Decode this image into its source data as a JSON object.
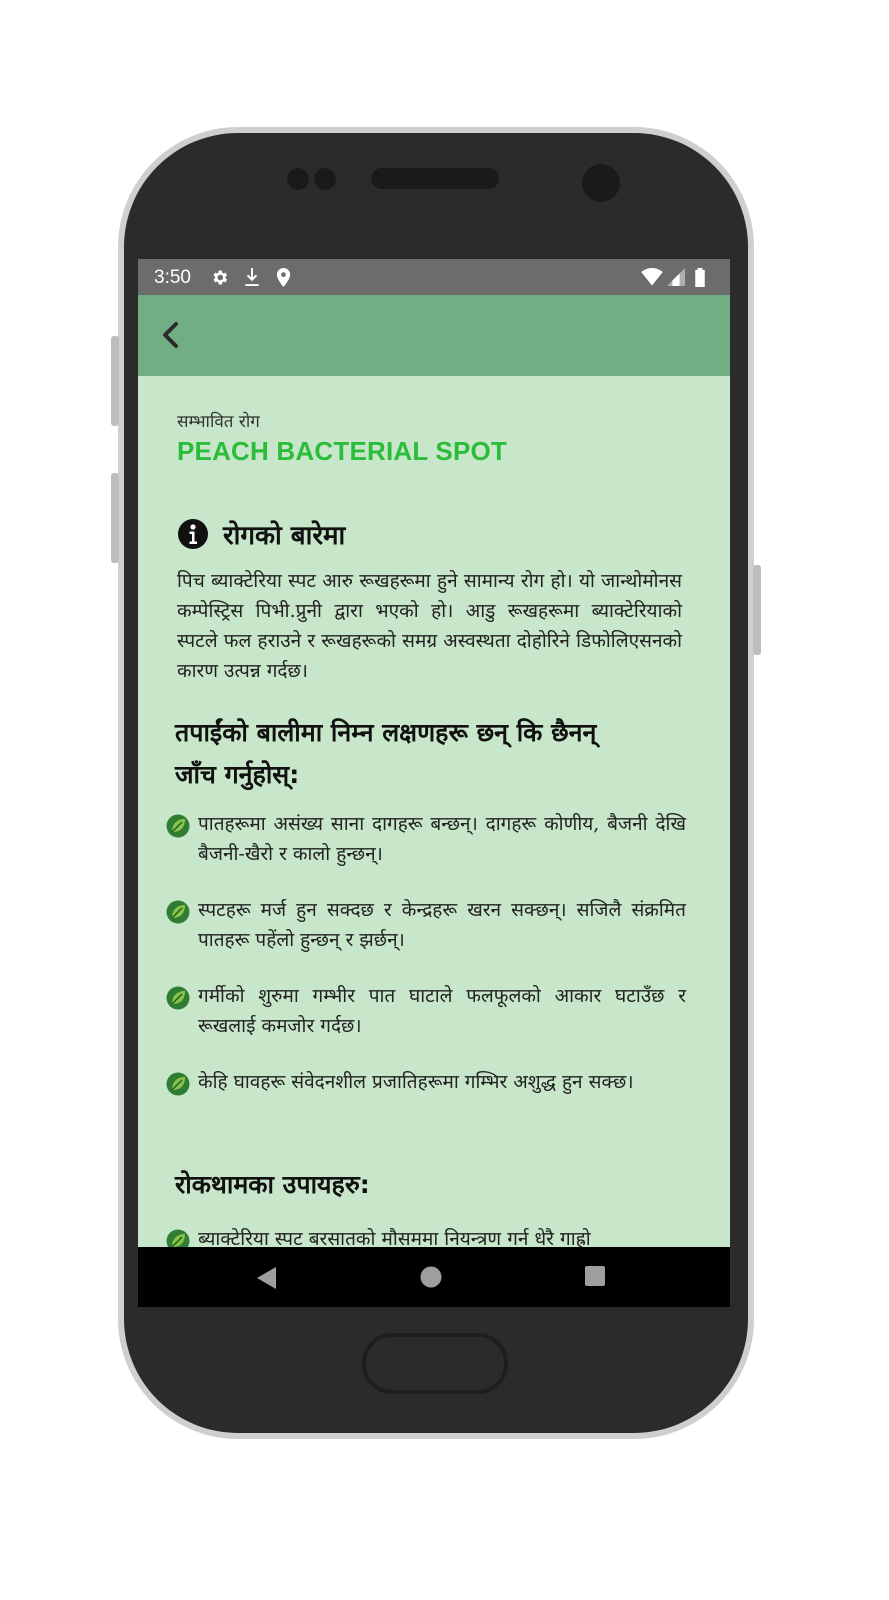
{
  "status_bar": {
    "time": "3:50",
    "left_icons": [
      "gear-icon",
      "download-icon",
      "location-pin-icon"
    ],
    "right_icons": [
      "wifi-icon",
      "signal-icon",
      "battery-icon"
    ]
  },
  "app_bar": {
    "back_icon": "chevron-left-icon",
    "color": "#71ae86"
  },
  "content": {
    "label": "सम्भावित रोग",
    "disease_name": "PEACH BACTERIAL SPOT",
    "about": {
      "icon": "info-icon",
      "title": "रोगको बारेमा",
      "text": "पिच ब्याक्टेरिया स्पट आरु रूखहरूमा हुने सामान्य रोग हो। यो जान्थोमोनस कम्पेस्ट्रिस पिभी.प्रुनी द्वारा भएको हो। आडु रूखहरूमा ब्याक्टेरियाको स्पटले फल हराउने र रूखहरूको समग्र अस्वस्थता दोहोरिने डिफोलिएसनको कारण उत्पन्न गर्दछ।"
    },
    "symptoms": {
      "title": "तपाईंको बालीमा निम्न लक्षणहरू छन् कि छैनन् जाँच गर्नुहोस्:",
      "items": [
        "पातहरूमा असंख्य साना दागहरू बन्छन्। दागहरू कोणीय, बैजनी देखि बैजनी-खैरो र कालो हुन्छन्।",
        "स्पटहरू मर्ज हुन सक्दछ र केन्द्रहरू खरन सक्छन्। सजिलै संक्रमित पातहरू पहेंलो हुन्छन् र झर्छन्।",
        "गर्मीको शुरुमा गम्भीर पात घाटाले फलफूलको आकार घटाउँछ र रूखलाई कमजोर गर्दछ।",
        "केहि घावहरू संवेदनशील प्रजातिहरूमा गम्भिर अशुद्ध हुन सक्छ।"
      ]
    },
    "prevention": {
      "title": "रोकथामका उपायहरु:",
      "items": [
        "ब्याक्टेरिया स्पट बरसातको मौसममा नियन्त्रण गर्न धेरै गाह्रो"
      ]
    }
  },
  "nav_bar": {
    "icons": [
      "back-triangle-icon",
      "home-circle-icon",
      "recents-square-icon"
    ]
  },
  "colors": {
    "background": "#c8e6c9",
    "accent": "#2bbd3a",
    "status_bar": "#6c6c6c",
    "app_bar": "#71ae86"
  }
}
